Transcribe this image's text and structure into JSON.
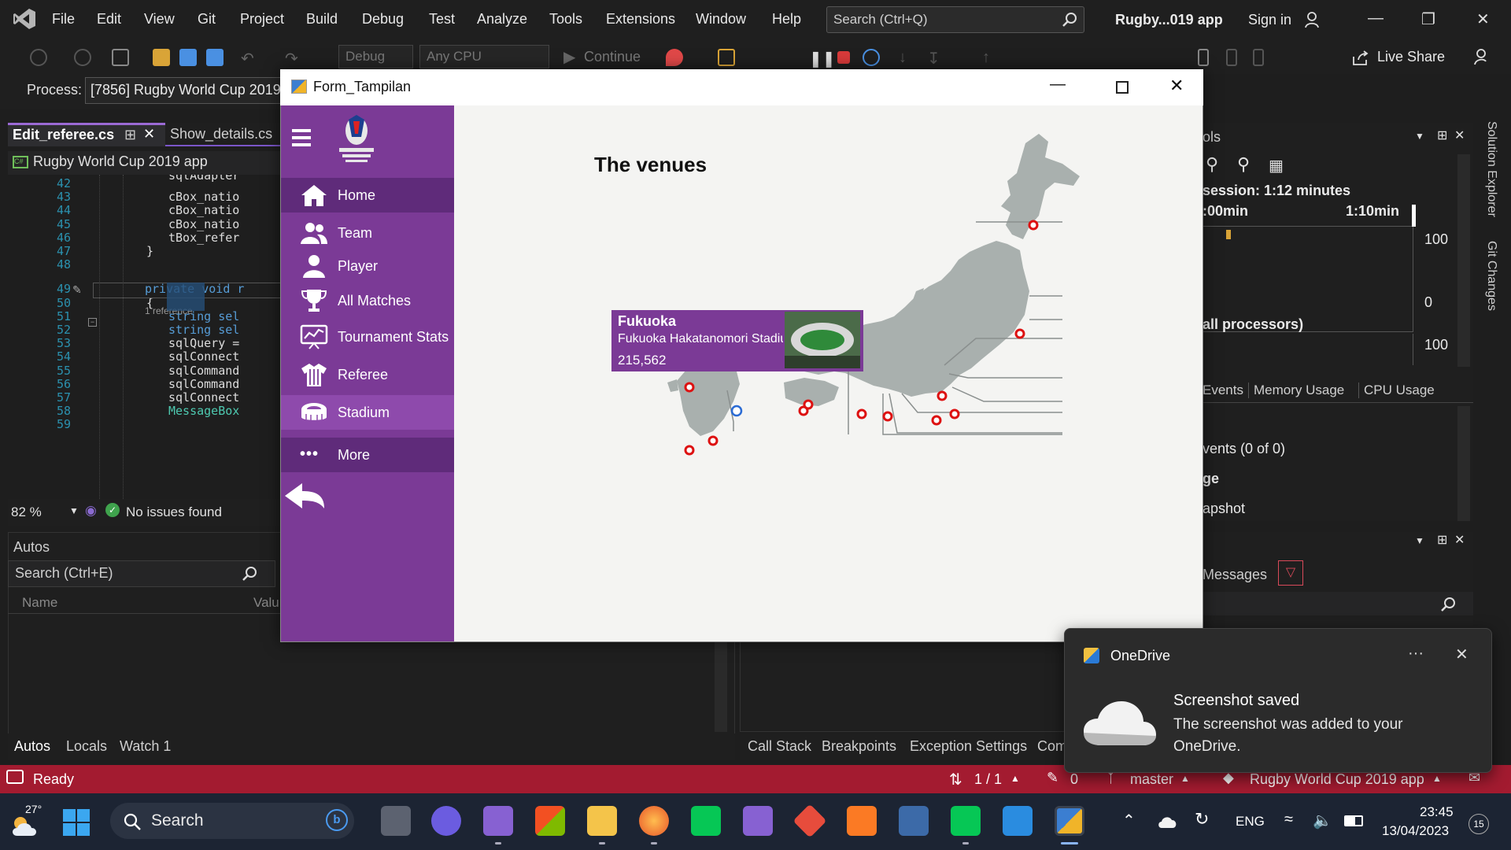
{
  "vs": {
    "menu": [
      "File",
      "Edit",
      "View",
      "Git",
      "Project",
      "Build",
      "Debug",
      "Test",
      "Analyze",
      "Tools",
      "Extensions",
      "Window",
      "Help"
    ],
    "search_placeholder": "Search (Ctrl+Q)",
    "solution_name": "Rugby...019 app",
    "sign_in": "Sign in",
    "toolbar": {
      "config": "Debug",
      "platform": "Any CPU",
      "continue": "Continue",
      "live_share": "Live Share"
    },
    "process_label": "Process:",
    "process_value": "[7856] Rugby World Cup 2019",
    "tabs": [
      "Edit_referee.cs",
      "Show_details.cs"
    ],
    "nav_project": "Rugby World Cup 2019 app",
    "code_lines": [
      {
        "n": "42",
        "t": ""
      },
      {
        "n": "43",
        "t": "cBox_natio"
      },
      {
        "n": "44",
        "t": "cBox_natio"
      },
      {
        "n": "45",
        "t": "cBox_natio"
      },
      {
        "n": "46",
        "t": "tBox_refer"
      },
      {
        "n": "47",
        "t": "}"
      },
      {
        "n": "48",
        "t": ""
      },
      {
        "n": "49",
        "t": "private void r"
      },
      {
        "n": "50",
        "t": "{"
      },
      {
        "n": "51",
        "t": "string sel"
      },
      {
        "n": "52",
        "t": "string sel"
      },
      {
        "n": "53",
        "t": "sqlQuery ="
      },
      {
        "n": "54",
        "t": "sqlConnect"
      },
      {
        "n": "55",
        "t": "sqlCommand"
      },
      {
        "n": "56",
        "t": "sqlCommand"
      },
      {
        "n": "57",
        "t": "sqlConnect"
      },
      {
        "n": "58",
        "t": "MessageBox"
      },
      {
        "n": "59",
        "t": ""
      }
    ],
    "code_top_partial": "sqlAdapter",
    "reference_hint": "1 reference",
    "zoom": "82 %",
    "no_issues": "No issues found",
    "autos_title": "Autos",
    "autos_search": "Search (Ctrl+E)",
    "autos_cols": [
      "Name",
      "Valu"
    ],
    "bottom_tabs_left": [
      "Autos",
      "Locals",
      "Watch 1"
    ],
    "bottom_tabs_right": [
      "Call Stack",
      "Breakpoints",
      "Exception Settings",
      "Com"
    ],
    "diag": {
      "header": "ols",
      "session": "session: 1:12 minutes",
      "t0": ":00min",
      "t1": "1:10min",
      "y100a": "100",
      "y0": "0",
      "processors": "all processors)",
      "y100b": "100",
      "tabs": [
        "Events",
        "Memory Usage",
        "CPU Usage"
      ],
      "rows": [
        "vents (0 of 0)",
        "ge",
        "apshot"
      ]
    },
    "output_messages": "Messages",
    "side_tabs": [
      "Solution Explorer",
      "Git Changes"
    ],
    "status": {
      "ready": "Ready",
      "lines": "1 / 1",
      "pencil": "0",
      "branch": "master",
      "project": "Rugby World Cup 2019 app"
    }
  },
  "form": {
    "title": "Form_Tampilan",
    "nav": [
      "Home",
      "Team",
      "Player",
      "All Matches",
      "Tournament Stats",
      "Referee",
      "Stadium",
      "More"
    ],
    "heading": "The venues",
    "card": {
      "city": "Fukuoka",
      "stadium": "Fukuoka Hakatanomori Stadium",
      "capacity": "215,562"
    }
  },
  "toast": {
    "app": "OneDrive",
    "title": "Screenshot saved",
    "body": "The screenshot was added to your OneDrive.",
    "more": "···"
  },
  "taskbar": {
    "weather": "27°",
    "search": "Search",
    "lang": "ENG",
    "time": "23:45",
    "date": "13/04/2023",
    "badge": "15"
  },
  "colors": {
    "accent_purple": "#7b3a96",
    "status_red": "#a31b30",
    "vs_bg": "#1f1f1f"
  }
}
